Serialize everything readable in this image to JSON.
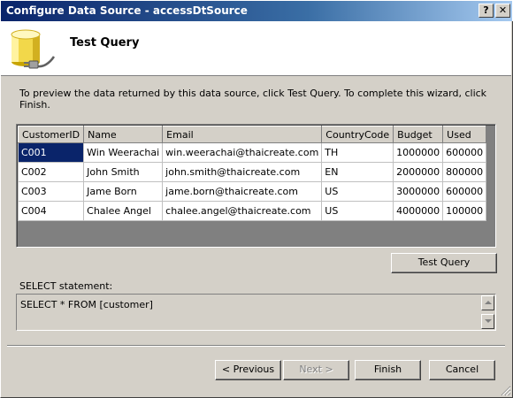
{
  "window": {
    "title": "Configure Data Source - accessDtSource",
    "help_label": "?",
    "close_label": "✕"
  },
  "header": {
    "title": "Test Query",
    "icon": "database-plug-icon"
  },
  "instructions": "To preview the data returned by this data source, click Test Query. To complete this wizard, click Finish.",
  "grid": {
    "columns": [
      "CustomerID",
      "Name",
      "Email",
      "CountryCode",
      "Budget",
      "Used"
    ],
    "rows": [
      [
        "C001",
        "Win Weerachai",
        "win.weerachai@thaicreate.com",
        "TH",
        "1000000",
        "600000"
      ],
      [
        "C002",
        "John Smith",
        "john.smith@thaicreate.com",
        "EN",
        "2000000",
        "800000"
      ],
      [
        "C003",
        "Jame Born",
        "jame.born@thaicreate.com",
        "US",
        "3000000",
        "600000"
      ],
      [
        "C004",
        "Chalee Angel",
        "chalee.angel@thaicreate.com",
        "US",
        "4000000",
        "100000"
      ]
    ],
    "selected_cell": "C001"
  },
  "test_query_label": "Test Query",
  "sql": {
    "label": "SELECT statement:",
    "value": "SELECT * FROM [customer]"
  },
  "nav": {
    "previous_label": "< Previous",
    "next_label": "Next >",
    "finish_label": "Finish",
    "cancel_label": "Cancel"
  }
}
